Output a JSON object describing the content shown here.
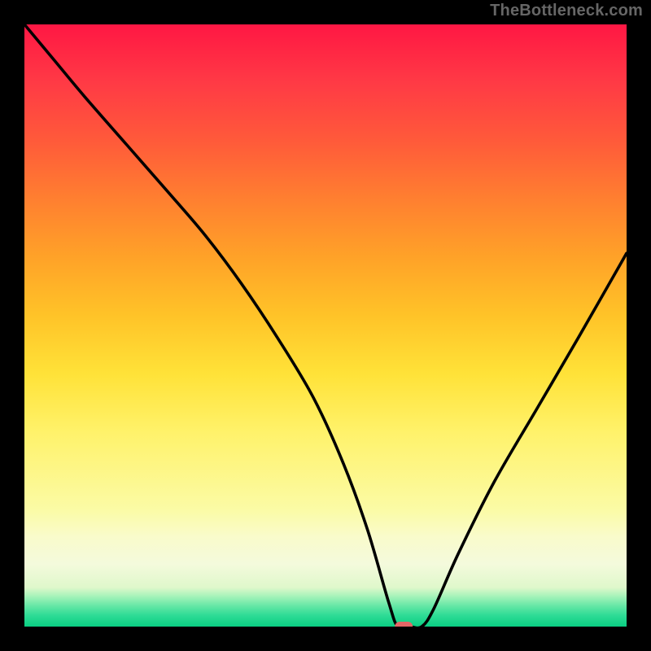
{
  "watermark": "TheBottleneck.com",
  "chart_data": {
    "type": "line",
    "title": "",
    "xlabel": "",
    "ylabel": "",
    "xlim": [
      0,
      100
    ],
    "ylim": [
      0,
      100
    ],
    "background": {
      "type": "vertical-gradient",
      "stops": [
        {
          "pos": 0,
          "color": "#FF1744"
        },
        {
          "pos": 0.24,
          "color": "#FF5A3A"
        },
        {
          "pos": 0.48,
          "color": "#FFA228"
        },
        {
          "pos": 0.72,
          "color": "#FFE238"
        },
        {
          "pos": 0.84,
          "color": "#FBFBA5"
        },
        {
          "pos": 0.935,
          "color": "#DFF8CB"
        },
        {
          "pos": 1.0,
          "color": "#0ACF83"
        }
      ]
    },
    "series": [
      {
        "name": "bottleneck-curve",
        "color": "#000000",
        "x": [
          0,
          5,
          10,
          17,
          24,
          30,
          36,
          42,
          48,
          53,
          57,
          60.5,
          62,
          64,
          66,
          68,
          72,
          78,
          85,
          92,
          100
        ],
        "values": [
          100,
          94,
          88,
          80,
          72,
          65,
          57,
          48,
          38,
          27,
          16,
          4,
          0,
          0,
          0,
          3,
          12,
          24,
          36,
          48,
          62
        ]
      }
    ],
    "marker": {
      "name": "optimal-marker",
      "x": 63,
      "y": 0,
      "color": "#E36666",
      "shape": "rounded-pill"
    }
  }
}
